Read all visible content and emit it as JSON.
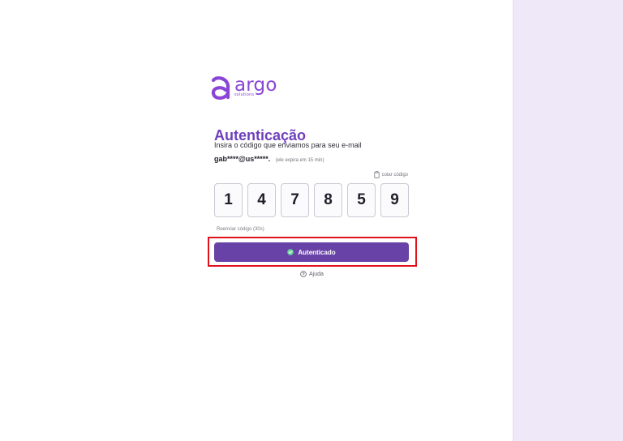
{
  "brand": {
    "name": "argo",
    "subname": "solutions",
    "logo_icon": "argo-logo-mark",
    "primary_color": "#8a45d6"
  },
  "auth": {
    "title": "Autenticação",
    "instruction": "Insira o código que enviamos para seu e-mail",
    "email_masked": "gab****@us*****.",
    "expiry_note": "(ele expira em 15 min)",
    "paste_label": "colar código",
    "paste_icon": "clipboard-icon",
    "code_digits": [
      "1",
      "4",
      "7",
      "8",
      "5",
      "9"
    ],
    "resend_label": "Reenviar código (30s)",
    "submit_label": "Autenticado",
    "submit_icon": "check-circle-icon",
    "help_label": "Ajuda",
    "help_icon": "question-circle-icon"
  },
  "colors": {
    "title": "#6d3fbc",
    "button": "#6842a7",
    "highlight": "#e1111b",
    "side_panel": "#efe8f8"
  }
}
